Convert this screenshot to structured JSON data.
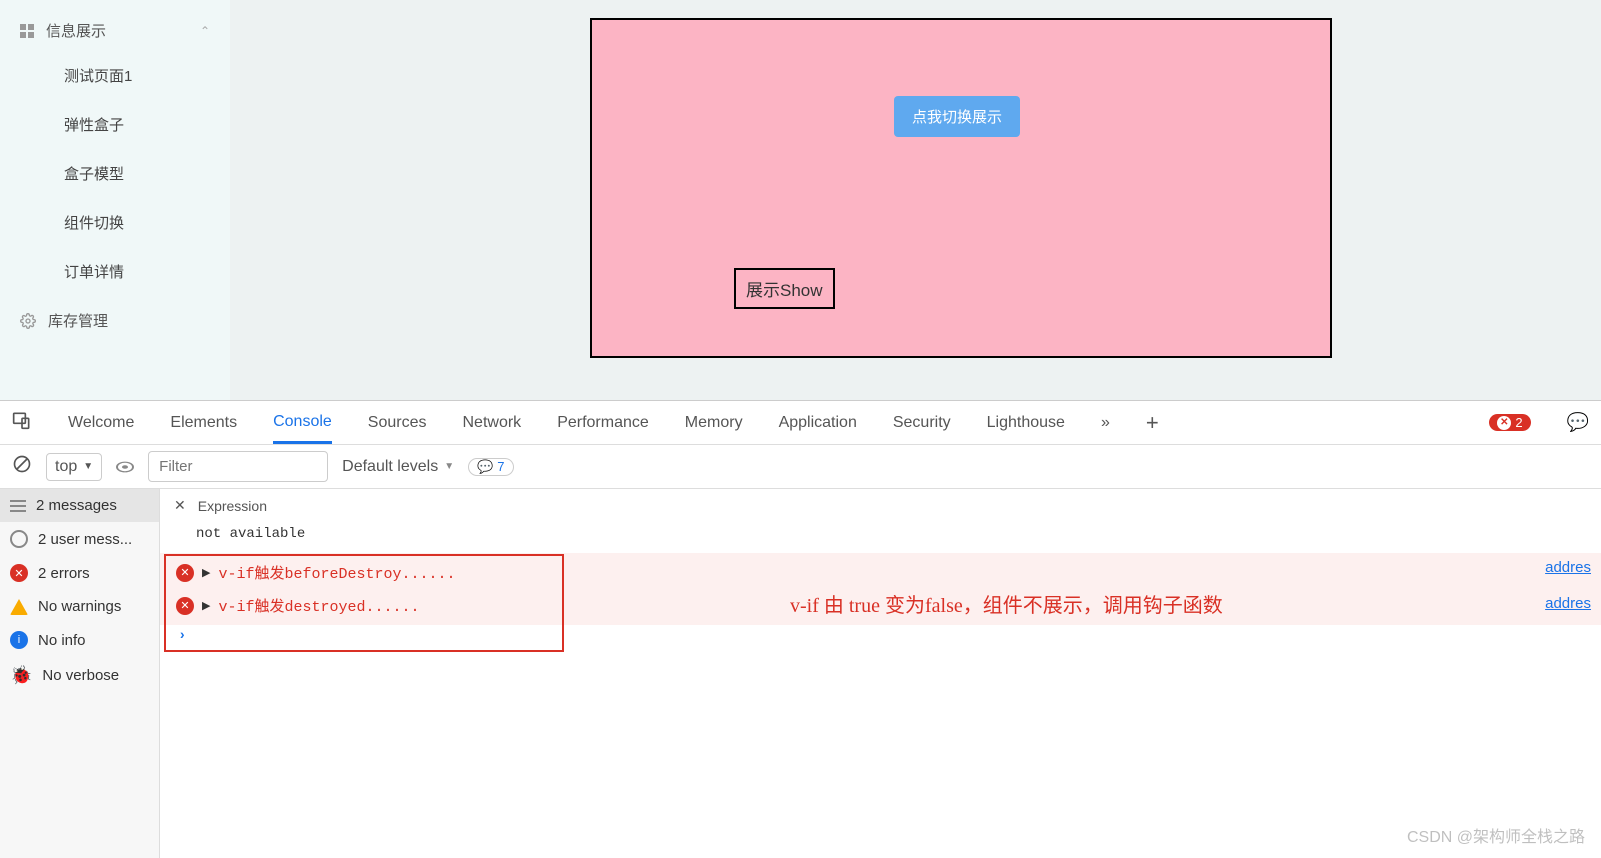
{
  "sidebar": {
    "group_label": "信息展示",
    "items": [
      "测试页面1",
      "弹性盒子",
      "盒子模型",
      "组件切换",
      "订单详情"
    ],
    "manage_label": "库存管理"
  },
  "main": {
    "toggle_button": "点我切换展示",
    "show_label": "展示Show"
  },
  "devtools": {
    "tabs": [
      "Welcome",
      "Elements",
      "Console",
      "Sources",
      "Network",
      "Performance",
      "Memory",
      "Application",
      "Security",
      "Lighthouse"
    ],
    "active_tab": "Console",
    "error_count": "2",
    "msg_count": "7",
    "filter_placeholder": "Filter",
    "levels_label": "Default levels",
    "context_label": "top",
    "expression_label": "Expression",
    "expression_value": "not available",
    "side": {
      "messages": "2 messages",
      "user": "2 user mess...",
      "errors": "2 errors",
      "warnings": "No warnings",
      "info": "No info",
      "verbose": "No verbose"
    },
    "logs": [
      "v-if触发beforeDestroy......",
      "v-if触发destroyed......"
    ],
    "source_link": "addres",
    "annotation": "v-if 由 true 变为false，组件不展示，调用钩子函数"
  },
  "watermark": "CSDN @架构师全栈之路"
}
